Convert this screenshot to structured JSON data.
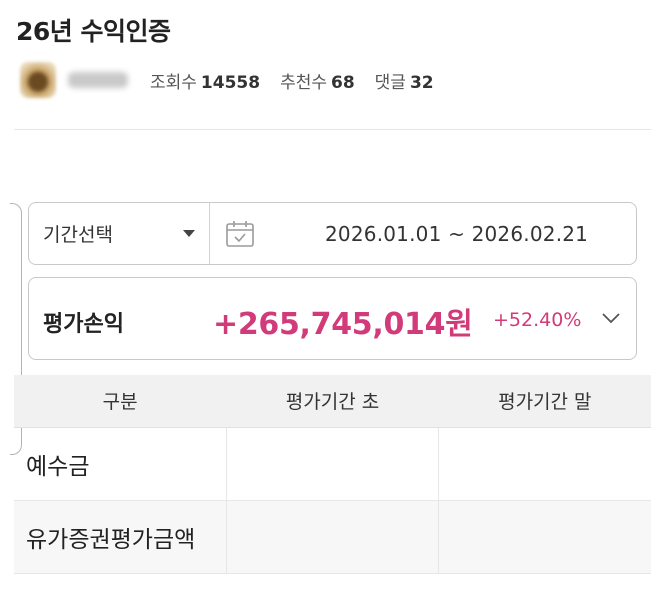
{
  "post": {
    "title": "26년 수익인증",
    "stats": [
      {
        "label": "조회수",
        "value": "14558"
      },
      {
        "label": "추천수",
        "value": "68"
      },
      {
        "label": "댓글",
        "value": "32"
      }
    ]
  },
  "filter": {
    "period_select": "기간선택",
    "date_range": "2026.01.01 ~ 2026.02.21"
  },
  "summary": {
    "label": "평가손익",
    "amount": "+265,745,014원",
    "rate": "+52.40%",
    "accent_color": "#d23b7a"
  },
  "table": {
    "headers": [
      "구분",
      "평가기간 초",
      "평가기간 말"
    ],
    "rows": [
      [
        "예수금",
        "",
        ""
      ],
      [
        "유가증권평가금액",
        "",
        ""
      ]
    ]
  }
}
